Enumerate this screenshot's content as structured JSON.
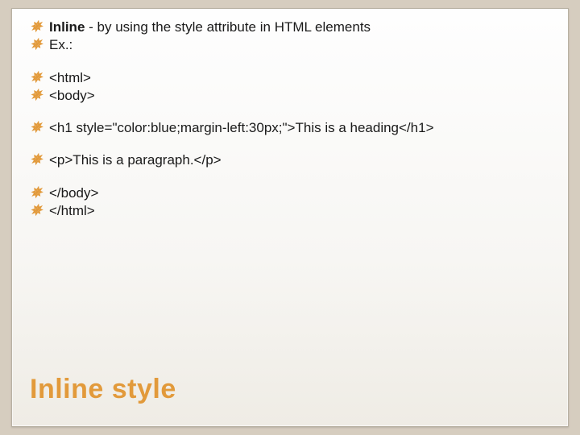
{
  "bullets": {
    "b1_bold": "Inline",
    "b1_rest": " - by using the style attribute in HTML elements",
    "b2": "Ex.:",
    "b3": "<html>",
    "b4": "<body>",
    "b5": "<h1 style=\"color:blue;margin-left:30px;\">This is a heading</h1>",
    "b6": "<p>This is a paragraph.</p>",
    "b7": "</body>",
    "b8": "</html>"
  },
  "title": "Inline style",
  "glyph": "་"
}
